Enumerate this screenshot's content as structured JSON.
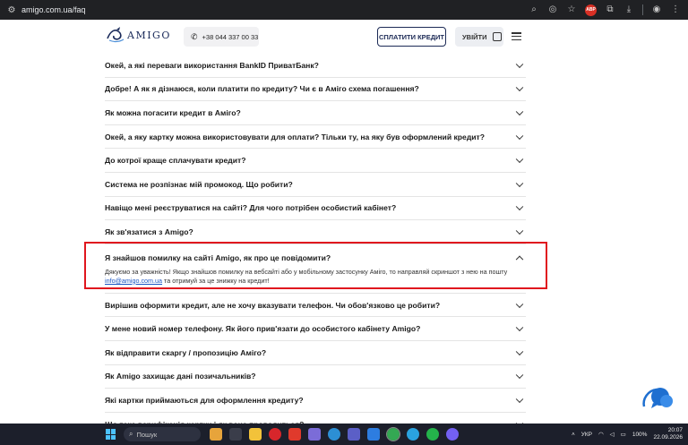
{
  "browser": {
    "url": "amigo.com.ua/faq",
    "extension_badge": "ABP"
  },
  "header": {
    "logo_text": "AMIGO",
    "phone": "+38 044 337 00 33",
    "pay_button": "СПЛАТИТИ КРЕДИТ",
    "login_button": "УВІЙТИ"
  },
  "faq": {
    "items": [
      {
        "question": "Окей, а які переваги використання BankID ПриватБанк?"
      },
      {
        "question": "Добре! А як я дізнаюся, коли платити по кредиту? Чи є в Аміго схема погашення?"
      },
      {
        "question": "Як можна погасити кредит в Аміго?"
      },
      {
        "question": "Окей, а яку картку можна використовувати для оплати? Тільки ту, на яку був оформлений кредит?"
      },
      {
        "question": "До котрої краще сплачувати кредит?"
      },
      {
        "question": "Система не розпізнає мій промокод. Що робити?"
      },
      {
        "question": "Навіщо мені реєструватися на сайті? Для чого потрібен особистий кабінет?"
      },
      {
        "question": "Як зв'язатися з Amigo?"
      }
    ],
    "open_item": {
      "question": "Я знайшов помилку на сайті Amigo, як про це повідомити?",
      "answer_part1": "Дякуємо за уважність! Якщо знайшов помилку на вебсайті або у мобільному застосунку Аміго, то направляй скриншот з нею на пошту ",
      "answer_email": "info@amigo.com.ua",
      "answer_part2": " та отримуй за це знижку на кредит!"
    },
    "items_after": [
      {
        "question": "Вирішив оформити кредит, але не хочу вказувати телефон. Чи обов'язково це робити?"
      },
      {
        "question": "У мене новий номер телефону. Як його прив'язати до особистого кабінету Amigo?"
      },
      {
        "question": "Як відправити скаргу / пропозицію Аміго?"
      },
      {
        "question": "Як Amigo захищає дані позичальників?"
      },
      {
        "question": "Які картки приймаються для оформлення кредиту?"
      },
      {
        "question": "Що таке верифікація картки і як вона проводиться?"
      }
    ]
  },
  "taskbar": {
    "search_label": "Пошук",
    "language": "УКР",
    "battery": "100%",
    "time": "20:07",
    "date": "22.09.2026"
  },
  "colors": {
    "brand_navy": "#1c2a56",
    "highlight_red": "#e0161e",
    "link_blue": "#1a56c4"
  }
}
